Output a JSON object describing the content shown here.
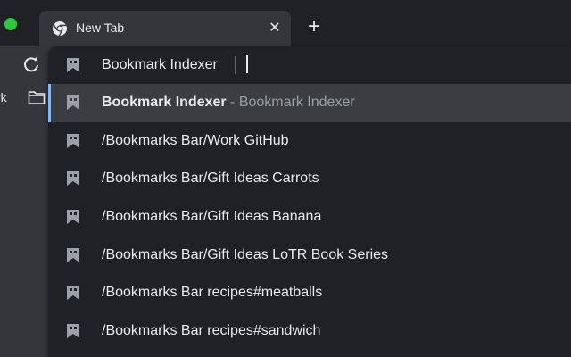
{
  "tab": {
    "title": "New Tab",
    "close_glyph": "✕",
    "icon": "chrome-logo-icon"
  },
  "new_tab_glyph": "+",
  "toolbar": {
    "forward_glyph": "›",
    "reload_icon": "reload-icon"
  },
  "bookmarks_bar": {
    "partial_label": "rk",
    "folder_icon": "folder-icon"
  },
  "omnibox": {
    "input_value": "Bookmark Indexer",
    "suggestions": [
      {
        "title": "Bookmark Indexer",
        "separator": " - ",
        "description": "Bookmark Indexer",
        "selected": true,
        "icon": "bookmark-icon"
      },
      {
        "title": "/Bookmarks Bar/Work GitHub",
        "icon": "bookmark-icon"
      },
      {
        "title": "/Bookmarks Bar/Gift Ideas Carrots",
        "icon": "bookmark-icon"
      },
      {
        "title": "/Bookmarks Bar/Gift Ideas Banana",
        "icon": "bookmark-icon"
      },
      {
        "title": "/Bookmarks Bar/Gift Ideas LoTR Book Series",
        "icon": "bookmark-icon"
      },
      {
        "title": "/Bookmarks Bar recipes#meatballs",
        "icon": "bookmark-icon"
      },
      {
        "title": "/Bookmarks Bar recipes#sandwich",
        "icon": "bookmark-icon"
      }
    ]
  },
  "colors": {
    "accent": "#8ab4f8",
    "popup_bg": "#202124",
    "selected_bg": "#3c3d41",
    "window_green": "#2ec840"
  }
}
